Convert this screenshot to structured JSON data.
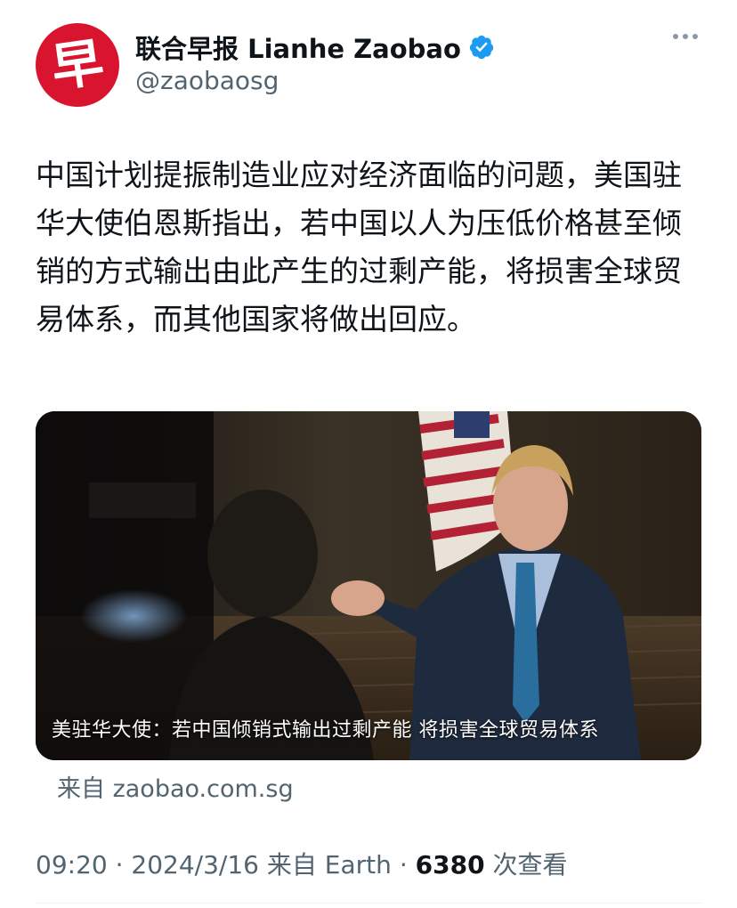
{
  "author": {
    "avatar_glyph": "早",
    "display_name": "联合早报 Lianhe Zaobao",
    "handle": "@zaobaosg",
    "verified": true,
    "avatar_color": "#d8142e",
    "verified_color": "#1d9bf0"
  },
  "tweet": {
    "text": "中国计划提振制造业应对经济面临的问题，美国驻华大使伯恩斯指出，若中国以人为压低价格甚至倾销的方式输出由此产生的过剩产能，将损害全球贸易体系，而其他国家将做出回应。"
  },
  "media": {
    "caption": "美驻华大使：若中国倾销式输出过剩产能 将损害全球贸易体系",
    "source": "来自 zaobao.com.sg"
  },
  "meta": {
    "time": "09:20",
    "date": "2024/3/16",
    "client": "来自 Earth",
    "separator": "·",
    "views_count": "6380",
    "views_label": "次查看"
  },
  "icons": {
    "more": "more-horizontal-icon",
    "verified": "verified-badge-icon"
  }
}
